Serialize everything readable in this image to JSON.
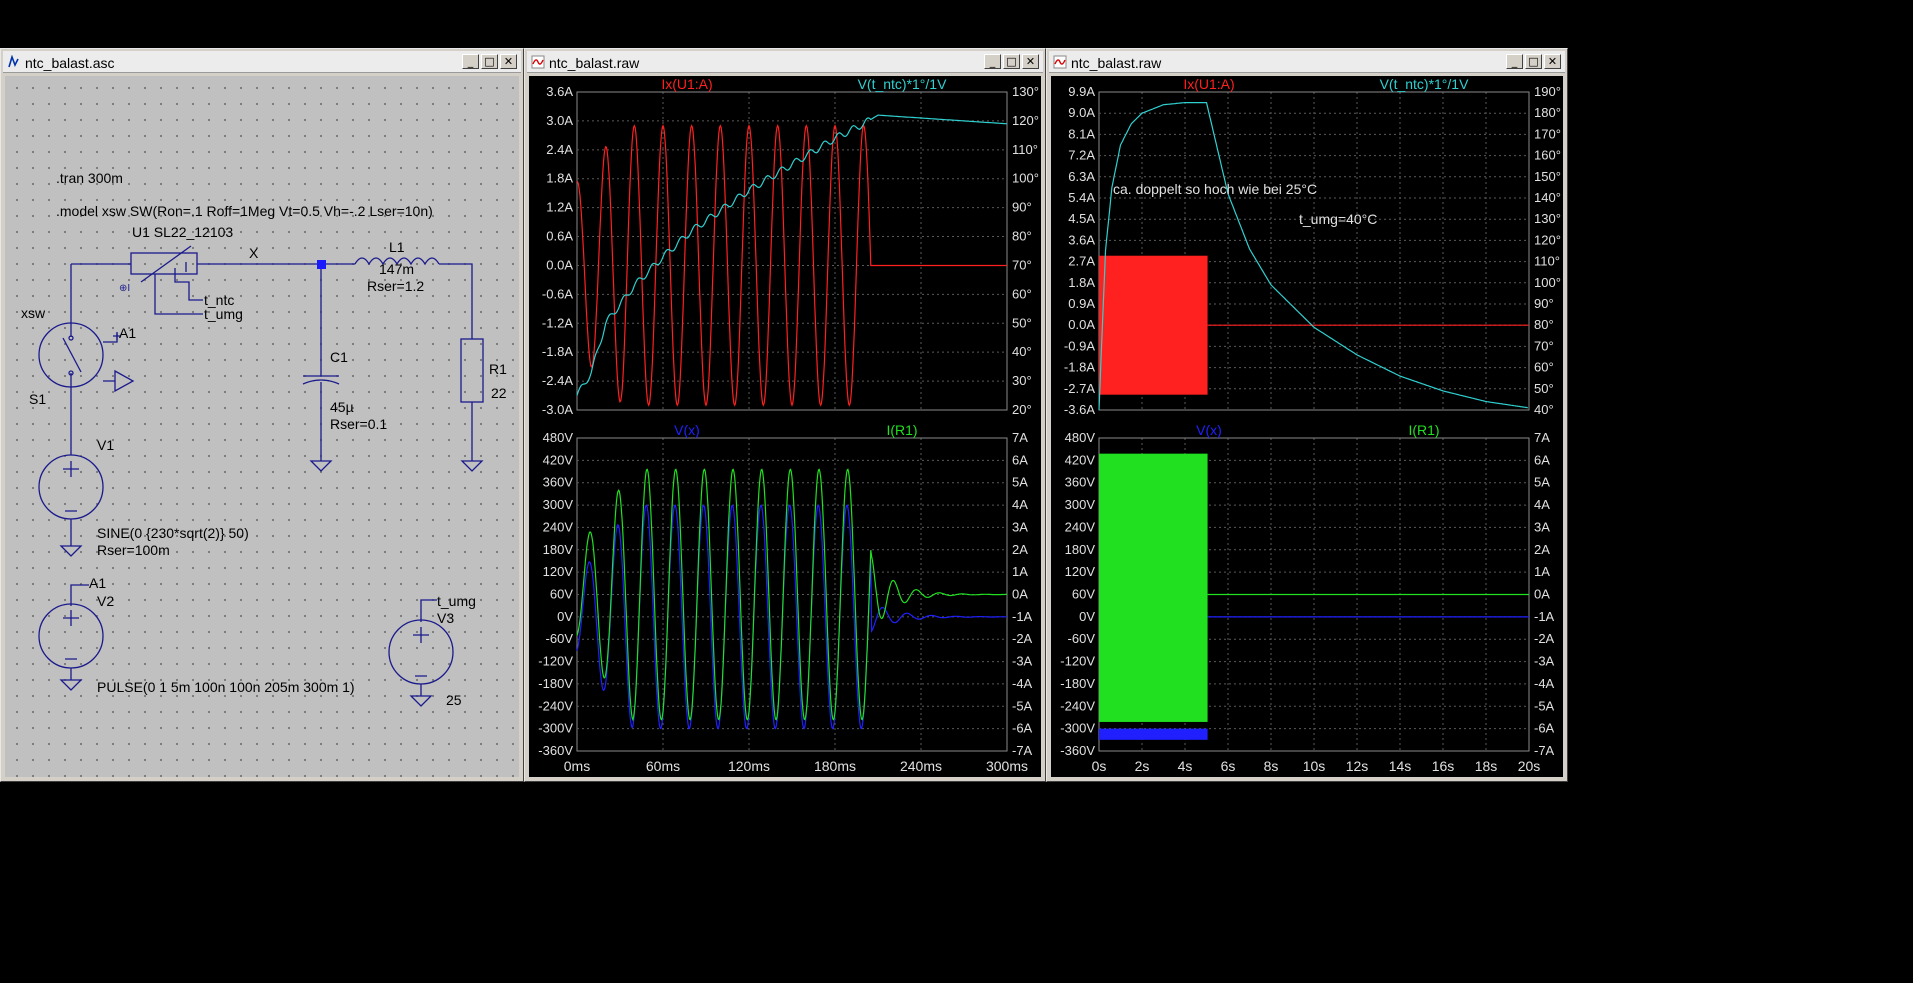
{
  "schematic": {
    "title": "ntc_balast.asc",
    "directives": [
      ".tran 300m",
      ".model xsw SW(Ron=.1 Roff=1Meg Vt=0.5 Vh=-.2 Lser=10n)"
    ],
    "components": {
      "u1": {
        "label": "U1  SL22_12103",
        "pin_ntc": "t_ntc",
        "pin_umg": "t_umg"
      },
      "net_x": "X",
      "s1": {
        "model": "xsw",
        "name": "S1",
        "ctrl": "A1"
      },
      "l1": {
        "name": "L1",
        "value": "147m",
        "rser": "Rser=1.2"
      },
      "c1": {
        "name": "C1",
        "value": "45µ",
        "rser": "Rser=0.1"
      },
      "r1": {
        "name": "R1",
        "value": "22"
      },
      "v1": {
        "name": "V1",
        "spec": "SINE(0 {230*sqrt(2)} 50)",
        "rser": "Rser=100m"
      },
      "v2": {
        "name": "V2",
        "net": "A1",
        "spec": "PULSE(0 1 5m 100n 100n 205m 300m 1)"
      },
      "v3": {
        "name": "V3",
        "net": "t_umg",
        "value": "25"
      }
    }
  },
  "plots": [
    {
      "title": "ntc_balast.raw",
      "x_ticks": [
        "0ms",
        "60ms",
        "120ms",
        "180ms",
        "240ms",
        "300ms"
      ],
      "panes": [
        {
          "left_trace": {
            "label": "Ix(U1:A)",
            "color": "#ff2020"
          },
          "right_trace": {
            "label": "V(t_ntc)*1°/1V",
            "color": "#30d0d0"
          },
          "left_ticks": [
            "3.6A",
            "3.0A",
            "2.4A",
            "1.8A",
            "1.2A",
            "0.6A",
            "0.0A",
            "-0.6A",
            "-1.2A",
            "-1.8A",
            "-2.4A",
            "-3.0A"
          ],
          "right_ticks": [
            "130°",
            "120°",
            "110°",
            "100°",
            "90°",
            "80°",
            "70°",
            "60°",
            "50°",
            "40°",
            "30°",
            "20°"
          ],
          "annotations": []
        },
        {
          "left_trace": {
            "label": "V(x)",
            "color": "#2020ff"
          },
          "right_trace": {
            "label": "I(R1)",
            "color": "#20e020"
          },
          "left_ticks": [
            "480V",
            "420V",
            "360V",
            "300V",
            "240V",
            "180V",
            "120V",
            "60V",
            "0V",
            "-60V",
            "-120V",
            "-180V",
            "-240V",
            "-300V",
            "-360V"
          ],
          "right_ticks": [
            "7A",
            "6A",
            "5A",
            "4A",
            "3A",
            "2A",
            "1A",
            "0A",
            "-1A",
            "-2A",
            "-3A",
            "-4A",
            "-5A",
            "-6A",
            "-7A"
          ],
          "annotations": []
        }
      ]
    },
    {
      "title": "ntc_balast.raw",
      "x_ticks": [
        "0s",
        "2s",
        "4s",
        "6s",
        "8s",
        "10s",
        "12s",
        "14s",
        "16s",
        "18s",
        "20s"
      ],
      "panes": [
        {
          "left_trace": {
            "label": "Ix(U1:A)",
            "color": "#ff2020"
          },
          "right_trace": {
            "label": "V(t_ntc)*1°/1V",
            "color": "#30d0d0"
          },
          "left_ticks": [
            "9.9A",
            "9.0A",
            "8.1A",
            "7.2A",
            "6.3A",
            "5.4A",
            "4.5A",
            "3.6A",
            "2.7A",
            "1.8A",
            "0.9A",
            "0.0A",
            "-0.9A",
            "-1.8A",
            "-2.7A",
            "-3.6A"
          ],
          "right_ticks": [
            "190°",
            "180°",
            "170°",
            "160°",
            "150°",
            "140°",
            "130°",
            "120°",
            "110°",
            "100°",
            "90°",
            "80°",
            "70°",
            "60°",
            "50°",
            "40°"
          ],
          "annotations": [
            "ca. doppelt so hoch wie bei 25°C",
            "t_umg=40°C"
          ]
        },
        {
          "left_trace": {
            "label": "V(x)",
            "color": "#2020ff"
          },
          "right_trace": {
            "label": "I(R1)",
            "color": "#20e020"
          },
          "left_ticks": [
            "480V",
            "420V",
            "360V",
            "300V",
            "240V",
            "180V",
            "120V",
            "60V",
            "0V",
            "-60V",
            "-120V",
            "-180V",
            "-240V",
            "-300V",
            "-360V"
          ],
          "right_ticks": [
            "7A",
            "6A",
            "5A",
            "4A",
            "3A",
            "2A",
            "1A",
            "0A",
            "-1A",
            "-2A",
            "-3A",
            "-4A",
            "-5A",
            "-6A",
            "-7A"
          ],
          "annotations": []
        }
      ]
    }
  ],
  "chart_data": [
    {
      "type": "line",
      "title": "",
      "x_unit": "ms",
      "xlim": [
        0,
        300
      ],
      "series": [
        {
          "name": "Ix(U1:A)",
          "axis": "left",
          "ylim": [
            -3.0,
            3.6
          ],
          "shape": "50 Hz sine, peak ≈2.9A, 0 to 205 ms, then 0.0A"
        },
        {
          "name": "V(t_ntc)*1°/1V",
          "axis": "right",
          "ylim": [
            20,
            130
          ],
          "x": [
            0,
            10,
            20,
            40,
            60,
            80,
            100,
            120,
            140,
            160,
            180,
            200,
            210,
            240,
            270,
            300
          ],
          "values": [
            25,
            33,
            50,
            63,
            73,
            82,
            89,
            96,
            102,
            108,
            114,
            119,
            122,
            121,
            120,
            119
          ]
        },
        {
          "name": "V(x)",
          "axis": "left",
          "ylim": [
            -360,
            480
          ],
          "shape": "50 Hz sine, peak ≈ -300V..300V, 0 to 205 ms, ringing to 0V after"
        },
        {
          "name": "I(R1)",
          "axis": "right",
          "ylim": [
            -7,
            7
          ],
          "shape": "50 Hz sine, peak ≈5.7A..-5.4A, 0 to 205 ms, decaying ringing to 0A"
        }
      ]
    },
    {
      "type": "line",
      "title": "",
      "x_unit": "s",
      "xlim": [
        0,
        20
      ],
      "series": [
        {
          "name": "Ix(U1:A)",
          "axis": "left",
          "ylim": [
            -3.6,
            9.9
          ],
          "shape": "envelope ≈ ±2.9A from 0 to 5 s, then 0.0A"
        },
        {
          "name": "V(t_ntc)*1°/1V",
          "axis": "right",
          "ylim": [
            40,
            190
          ],
          "x": [
            0,
            0.3,
            0.6,
            1,
            1.5,
            2,
            3,
            4,
            5,
            6,
            7,
            8,
            9,
            10,
            12,
            14,
            16,
            18,
            20
          ],
          "values": [
            40,
            115,
            145,
            165,
            175,
            180,
            184,
            185,
            185,
            142,
            116,
            99,
            89,
            79,
            66,
            56,
            49,
            44,
            41
          ]
        },
        {
          "name": "V(x)",
          "axis": "left",
          "ylim": [
            -360,
            480
          ],
          "shape": "envelope ≈ ±325V from 0 to 5 s, then 0V"
        },
        {
          "name": "I(R1)",
          "axis": "right",
          "ylim": [
            -7,
            7
          ],
          "shape": "envelope ≈ 6.4A..-5.7A from 0 to 5 s, then 0A"
        }
      ]
    }
  ]
}
